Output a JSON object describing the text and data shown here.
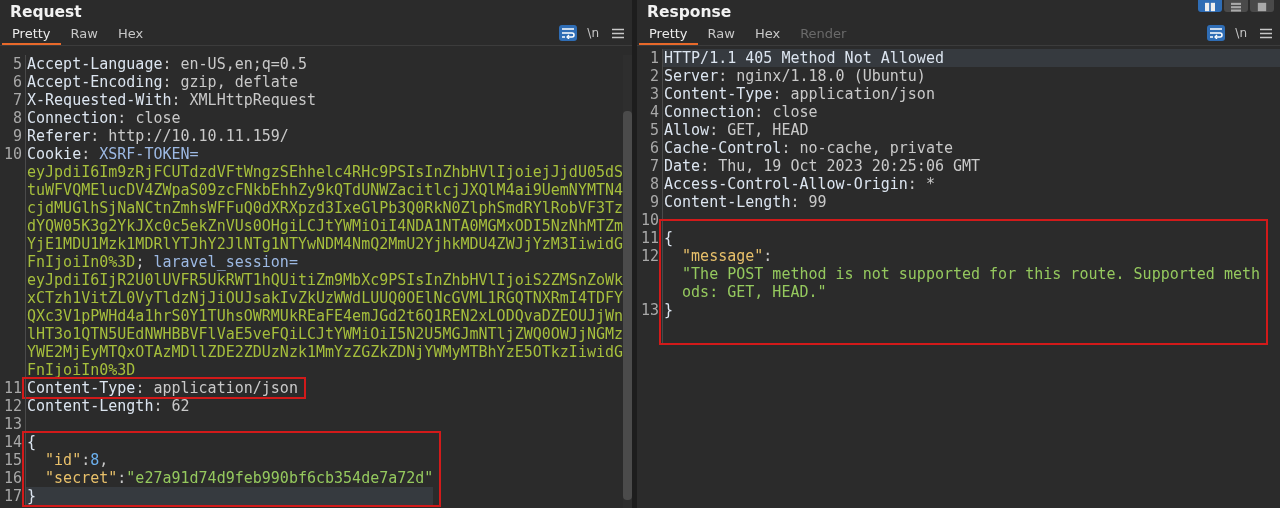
{
  "request": {
    "title": "Request",
    "tabs": [
      {
        "label": "Pretty",
        "selected": true,
        "disabled": false
      },
      {
        "label": "Raw",
        "selected": false,
        "disabled": false
      },
      {
        "label": "Hex",
        "selected": false,
        "disabled": false
      }
    ],
    "tools": [
      {
        "kind": "wrap",
        "on": true
      },
      {
        "kind": "newlines",
        "label": "\\n",
        "on": false
      },
      {
        "kind": "menu",
        "on": false
      }
    ],
    "blocks": [
      {
        "lines": [
          {
            "number": "5",
            "current": false,
            "tokens": [
              {
                "kind": "name",
                "text": "Accept-Language"
              },
              {
                "kind": "punct",
                "text": ": "
              },
              {
                "kind": "value",
                "text": "en-US,en;q=0.5"
              }
            ]
          },
          {
            "number": "6",
            "current": false,
            "tokens": [
              {
                "kind": "name",
                "text": "Accept-Encoding"
              },
              {
                "kind": "punct",
                "text": ": "
              },
              {
                "kind": "value",
                "text": "gzip, deflate"
              }
            ]
          },
          {
            "number": "7",
            "current": false,
            "tokens": [
              {
                "kind": "name",
                "text": "X-Requested-With"
              },
              {
                "kind": "punct",
                "text": ": "
              },
              {
                "kind": "value",
                "text": "XMLHttpRequest"
              }
            ]
          },
          {
            "number": "8",
            "current": false,
            "tokens": [
              {
                "kind": "name",
                "text": "Connection"
              },
              {
                "kind": "punct",
                "text": ": "
              },
              {
                "kind": "value",
                "text": "close"
              }
            ]
          },
          {
            "number": "9",
            "current": false,
            "tokens": [
              {
                "kind": "name",
                "text": "Referer"
              },
              {
                "kind": "punct",
                "text": ": "
              },
              {
                "kind": "value",
                "text": "http://10.10.11.159/"
              }
            ]
          },
          {
            "number": "10",
            "current": false,
            "tokens": [
              {
                "kind": "name",
                "text": "Cookie"
              },
              {
                "kind": "punct",
                "text": ": "
              },
              {
                "kind": "cookie-name",
                "text": "XSRF-TOKEN="
              },
              {
                "kind": "cookie-value",
                "text": "eyJpdiI6Im9zRjFCUTdzdVFtWngzSEhhelc4RHc9PSIsInZhbHVlIjoiejJjdU05dStuWFVQMElucDV4ZWpaS09zcFNkbEhhZy9kQTdUNWZacitlcjJXQlM4ai9UemNYMTN4cjdMUGlhSjNaNCtnZmhsWFFuQ0dXRXpzd3IxeGlPb3Q0RkN0ZlphSmdRYlRobVF3TzdYQW05K3g2YkJXc0c5ekZnVUs0OHgiLCJtYWMiOiI4NDA1NTA0MGMxODI5NzNhMTZmYjE1MDU1Mzk1MDRlYTJhY2JlNTg1NTYwNDM4NmQ2MmU2YjhkMDU4ZWJjYzM3IiwidGFnIjoiIn0%3D"
              },
              {
                "kind": "punct",
                "text": "; "
              },
              {
                "kind": "cookie-name",
                "text": "laravel_session="
              },
              {
                "kind": "cookie-value",
                "text": "eyJpdiI6IjR2U0lUVFR5UkRWT1hQUitiZm9MbXc9PSIsInZhbHVlIjoiS2ZMSnZoWkxCTzh1VitZL0VyTldzNjJiOUJsakIvZkUzWWdLUUQ0OElNcGVML1RGQTNXRmI4TDFYQXc3V1pPWHd4a1hrS0Y1TUhsOWRMUkREaFE4emJGd2t6Q1REN2xLODQvaDZEOUJjWnlHT3o1QTN5UEdNWHBBVFlVaE5veFQiLCJtYWMiOiI5N2U5MGJmNTljZWQ0OWJjNGMzYWE2MjEyMTQxOTAzMDllZDE2ZDUzNzk1MmYzZGZkZDNjYWMyMTBhYzE5OTkzIiwidGFnIjoiIn0%3D"
              }
            ]
          }
        ]
      },
      {
        "highlighted": true,
        "lines": [
          {
            "number": "11",
            "current": false,
            "tokens": [
              {
                "kind": "name",
                "text": "Content-Type"
              },
              {
                "kind": "punct",
                "text": ": "
              },
              {
                "kind": "value",
                "text": "application/json"
              }
            ]
          }
        ]
      },
      {
        "lines": [
          {
            "number": "12",
            "current": false,
            "tokens": [
              {
                "kind": "name",
                "text": "Content-Length"
              },
              {
                "kind": "punct",
                "text": ": "
              },
              {
                "kind": "value",
                "text": "62"
              }
            ]
          },
          {
            "number": "13",
            "current": false
          }
        ]
      },
      {
        "highlighted": true,
        "lines": [
          {
            "number": "14",
            "current": false,
            "tokens": [
              {
                "kind": "brace",
                "text": "{"
              }
            ]
          },
          {
            "number": "15",
            "current": false,
            "tokens": [
              {
                "kind": "indent"
              },
              {
                "kind": "json-key",
                "text": "\"id\""
              },
              {
                "kind": "punct",
                "text": ":"
              },
              {
                "kind": "number",
                "text": "8"
              },
              {
                "kind": "punct",
                "text": ","
              }
            ]
          },
          {
            "number": "16",
            "current": false,
            "tokens": [
              {
                "kind": "indent"
              },
              {
                "kind": "json-key",
                "text": "\"secret\""
              },
              {
                "kind": "punct",
                "text": ":"
              },
              {
                "kind": "string",
                "text": "\"e27a91d74d9feb990bf6cb354de7a72d\""
              }
            ]
          },
          {
            "number": "17",
            "current": true,
            "tokens": [
              {
                "kind": "brace",
                "text": "}"
              }
            ]
          }
        ]
      }
    ]
  },
  "response": {
    "title": "Response",
    "layout_buttons": [
      {
        "kind": "columns",
        "selected": true
      },
      {
        "kind": "rows",
        "selected": false
      },
      {
        "kind": "single",
        "selected": false
      }
    ],
    "tabs": [
      {
        "label": "Pretty",
        "selected": true,
        "disabled": false
      },
      {
        "label": "Raw",
        "selected": false,
        "disabled": false
      },
      {
        "label": "Hex",
        "selected": false,
        "disabled": false
      },
      {
        "label": "Render",
        "selected": false,
        "disabled": true
      }
    ],
    "tools": [
      {
        "kind": "wrap",
        "on": true
      },
      {
        "kind": "newlines",
        "label": "\\n",
        "on": false
      },
      {
        "kind": "menu",
        "on": false
      }
    ],
    "blocks": [
      {
        "lines": [
          {
            "number": "1",
            "current": true,
            "tokens": [
              {
                "kind": "name",
                "text": "HTTP/1.1 405 Method Not Allowed"
              }
            ]
          },
          {
            "number": "2",
            "current": false,
            "tokens": [
              {
                "kind": "name",
                "text": "Server"
              },
              {
                "kind": "punct",
                "text": ": "
              },
              {
                "kind": "value",
                "text": "nginx/1.18.0 (Ubuntu)"
              }
            ]
          },
          {
            "number": "3",
            "current": false,
            "tokens": [
              {
                "kind": "name",
                "text": "Content-Type"
              },
              {
                "kind": "punct",
                "text": ": "
              },
              {
                "kind": "value",
                "text": "application/json"
              }
            ]
          },
          {
            "number": "4",
            "current": false,
            "tokens": [
              {
                "kind": "name",
                "text": "Connection"
              },
              {
                "kind": "punct",
                "text": ": "
              },
              {
                "kind": "value",
                "text": "close"
              }
            ]
          },
          {
            "number": "5",
            "current": false,
            "tokens": [
              {
                "kind": "name",
                "text": "Allow"
              },
              {
                "kind": "punct",
                "text": ": "
              },
              {
                "kind": "value",
                "text": "GET, HEAD"
              }
            ]
          },
          {
            "number": "6",
            "current": false,
            "tokens": [
              {
                "kind": "name",
                "text": "Cache-Control"
              },
              {
                "kind": "punct",
                "text": ": "
              },
              {
                "kind": "value",
                "text": "no-cache, private"
              }
            ]
          },
          {
            "number": "7",
            "current": false,
            "tokens": [
              {
                "kind": "name",
                "text": "Date"
              },
              {
                "kind": "punct",
                "text": ": "
              },
              {
                "kind": "value",
                "text": "Thu, 19 Oct 2023 20:25:06 GMT"
              }
            ]
          },
          {
            "number": "8",
            "current": false,
            "tokens": [
              {
                "kind": "name",
                "text": "Access-Control-Allow-Origin"
              },
              {
                "kind": "punct",
                "text": ": "
              },
              {
                "kind": "value",
                "text": "*"
              }
            ]
          },
          {
            "number": "9",
            "current": false,
            "tokens": [
              {
                "kind": "name",
                "text": "Content-Length"
              },
              {
                "kind": "punct",
                "text": ": "
              },
              {
                "kind": "value",
                "text": "99"
              }
            ]
          },
          {
            "number": "10",
            "current": false
          }
        ]
      },
      {
        "highlighted": true,
        "lines": [
          {
            "number": "11",
            "current": false,
            "tokens": [
              {
                "kind": "brace",
                "text": "{"
              }
            ]
          },
          {
            "number": "12",
            "current": false,
            "tokens": [
              {
                "kind": "indent"
              },
              {
                "kind": "json-key",
                "text": "\"message\""
              },
              {
                "kind": "punct",
                "text": ":"
              },
              {
                "kind": "string-block",
                "text": "\"The POST method is not supported for this route. Supported methods: GET, HEAD.\""
              }
            ]
          },
          {
            "number": "13",
            "current": false,
            "tokens": [
              {
                "kind": "brace",
                "text": "}"
              }
            ]
          }
        ]
      }
    ]
  }
}
